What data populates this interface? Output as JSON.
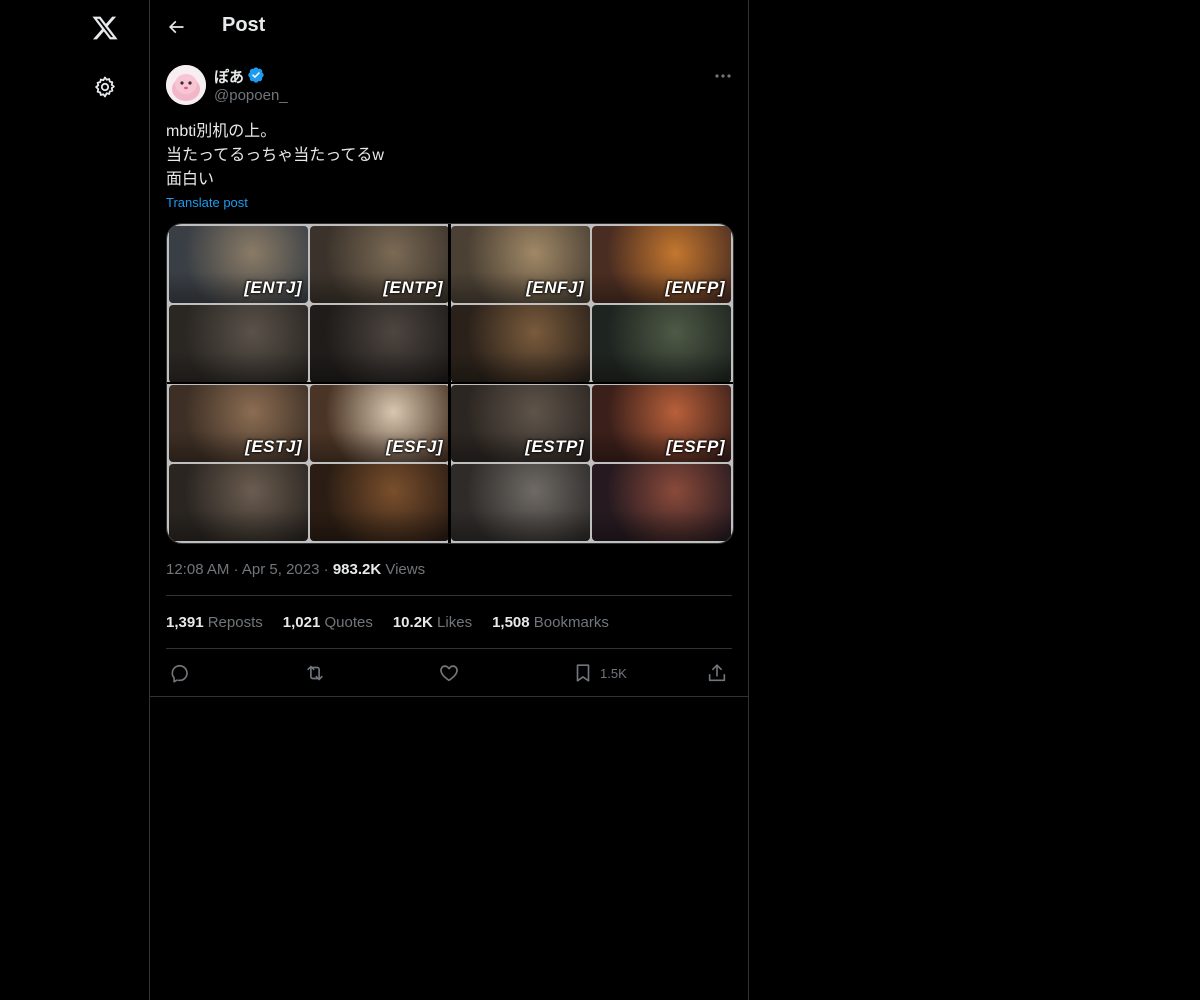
{
  "nav": {
    "logo_icon": "x-logo-icon",
    "settings_icon": "gear-icon"
  },
  "header": {
    "title": "Post"
  },
  "author": {
    "display_name": "ぽあ",
    "handle": "@popoen_",
    "verified": true
  },
  "post": {
    "lines": [
      "mbti別机の上。",
      "当たってるっちゃ当たってるw",
      "面白い"
    ],
    "translate_label": "Translate post"
  },
  "media": {
    "tiles": [
      {
        "label": "[ENTJ]",
        "colors": [
          "#3a3f45",
          "#8a7b66"
        ]
      },
      {
        "label": "[ENTP]",
        "colors": [
          "#3b332b",
          "#7b6a55"
        ]
      },
      {
        "label": "[ENFJ]",
        "colors": [
          "#4a4034",
          "#a08866"
        ]
      },
      {
        "label": "[ENFP]",
        "colors": [
          "#4a2d22",
          "#c4772e"
        ]
      },
      {
        "label": "",
        "colors": [
          "#2a2622",
          "#5a524a"
        ]
      },
      {
        "label": "",
        "colors": [
          "#1f1c1a",
          "#4d4540"
        ]
      },
      {
        "label": "",
        "colors": [
          "#2a211a",
          "#7a5b3c"
        ]
      },
      {
        "label": "",
        "colors": [
          "#1e2420",
          "#4f5a46"
        ]
      },
      {
        "label": "[ESTJ]",
        "colors": [
          "#3d2f25",
          "#8b6d52"
        ]
      },
      {
        "label": "[ESFJ]",
        "colors": [
          "#4a3425",
          "#d8c7b0"
        ]
      },
      {
        "label": "[ESTP]",
        "colors": [
          "#2c2622",
          "#5f544a"
        ]
      },
      {
        "label": "[ESFP]",
        "colors": [
          "#3a1f1a",
          "#b8603a"
        ]
      },
      {
        "label": "",
        "colors": [
          "#2a2521",
          "#6b5d50"
        ]
      },
      {
        "label": "",
        "colors": [
          "#2b1d14",
          "#7a4f2c"
        ]
      },
      {
        "label": "",
        "colors": [
          "#2e2b29",
          "#6f6a65"
        ]
      },
      {
        "label": "",
        "colors": [
          "#261a20",
          "#8a4a3a"
        ]
      }
    ]
  },
  "meta": {
    "time": "12:08 AM",
    "date": "Apr 5, 2023",
    "views_count": "983.2K",
    "views_label": "Views"
  },
  "stats": [
    {
      "count": "1,391",
      "label": "Reposts"
    },
    {
      "count": "1,021",
      "label": "Quotes"
    },
    {
      "count": "10.2K",
      "label": "Likes"
    },
    {
      "count": "1,508",
      "label": "Bookmarks"
    }
  ],
  "actions": {
    "bookmark_count": "1.5K"
  },
  "colors": {
    "accent": "#1d9bf0",
    "muted": "#71767b",
    "border": "#2f3336"
  }
}
